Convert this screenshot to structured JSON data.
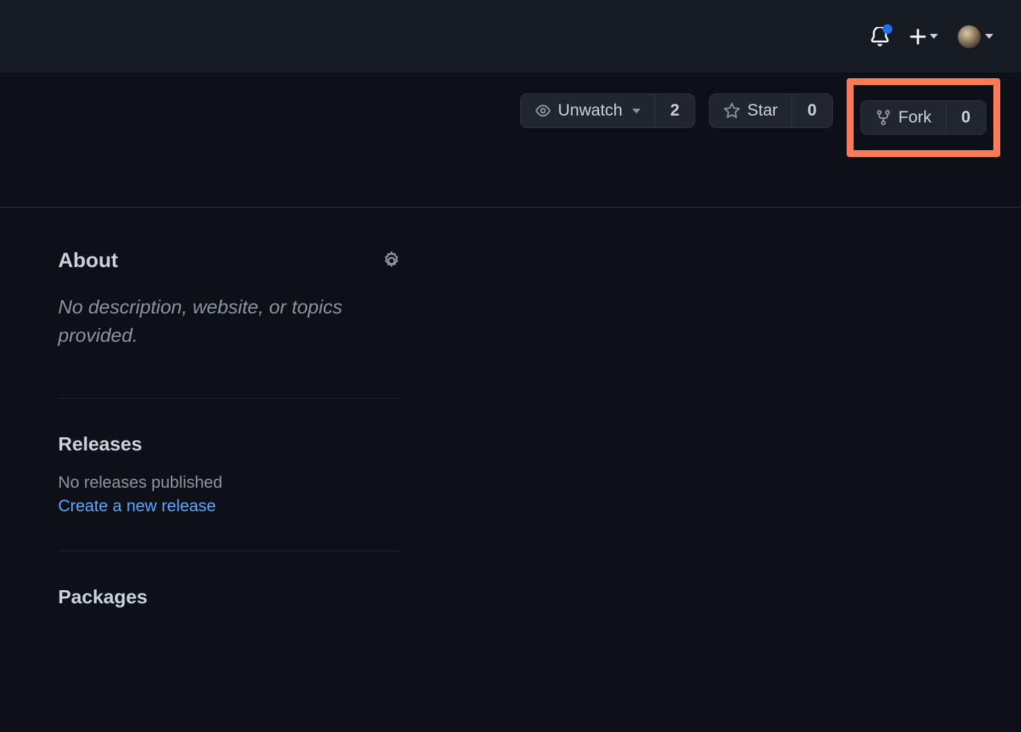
{
  "actions": {
    "unwatch": {
      "label": "Unwatch",
      "count": "2"
    },
    "star": {
      "label": "Star",
      "count": "0"
    },
    "fork": {
      "label": "Fork",
      "count": "0"
    }
  },
  "sidebar": {
    "about": {
      "title": "About",
      "description": "No description, website, or topics provided."
    },
    "releases": {
      "title": "Releases",
      "empty_text": "No releases published",
      "create_link": "Create a new release"
    },
    "packages": {
      "title": "Packages"
    }
  }
}
